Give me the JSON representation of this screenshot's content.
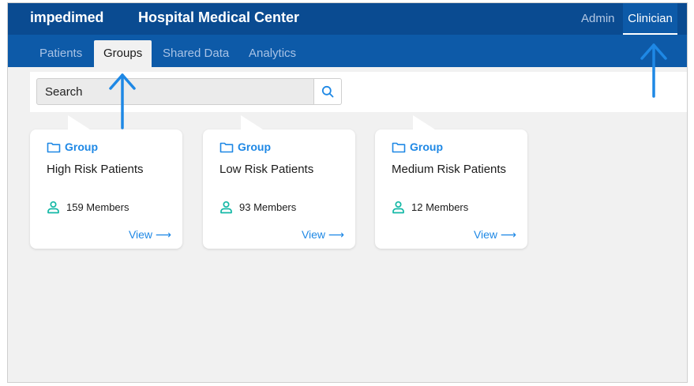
{
  "app": {
    "brand": "impedimed",
    "org": "Hospital Medical Center",
    "roles": [
      "Admin",
      "Clinician"
    ]
  },
  "tabs": [
    "Patients",
    "Groups",
    "Shared Data",
    "Analytics"
  ],
  "search": {
    "placeholder": "Search"
  },
  "groups": [
    {
      "type": "Group",
      "name": "High Risk Patients",
      "members": "159 Members",
      "view": "View ⟶"
    },
    {
      "type": "Group",
      "name": "Low Risk Patients",
      "members": "93 Members",
      "view": "View ⟶"
    },
    {
      "type": "Group",
      "name": "Medium Risk Patients",
      "members": "12 Members",
      "view": "View ⟶"
    }
  ],
  "colors": {
    "header": "#0a4b91",
    "tabbar": "#0d5aa8",
    "accent": "#1e88e5",
    "member_icon": "#14b8a6",
    "arrow": "#1e88e5"
  }
}
